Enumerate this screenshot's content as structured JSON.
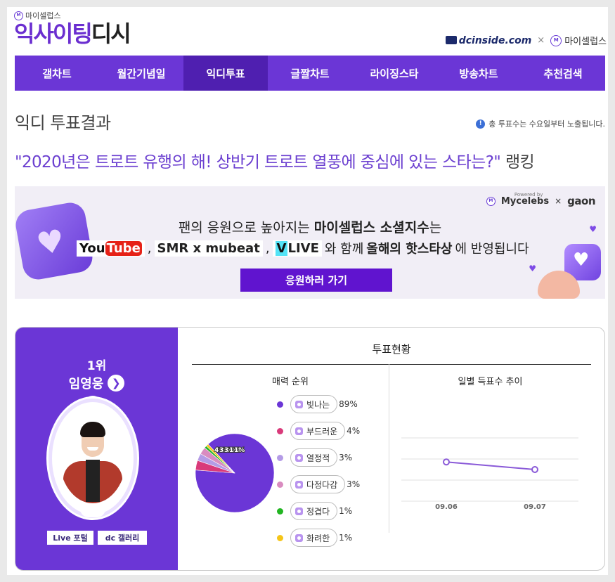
{
  "header": {
    "brand_small": "마이셀럽스",
    "brand_main": "익사이팅",
    "brand_accent": "디시",
    "partner_dc": "dcinside.com",
    "partner_times": "×",
    "partner_mc": "마이셀럽스"
  },
  "nav": {
    "items": [
      "갤차트",
      "월간기념일",
      "익디투표",
      "글짤차트",
      "라이징스타",
      "방송차트",
      "추천검색"
    ],
    "active_index": 2
  },
  "page": {
    "title": "익디 투표결과",
    "notice": "총 투표수는 수요일부터 노출됩니다.",
    "headline": "\"2020년은 트로트 유행의 해! 상반기 트로트 열풍에 중심에 있는 스타는?\"",
    "headline_suffix": "랭킹"
  },
  "banner": {
    "powered_by": "Powered by",
    "brand_a": "Mycelebs",
    "times": "×",
    "brand_b": "gaon",
    "line1_prefix": "팬의 응원으로 높아지는",
    "line1_bold": "마이셀럽스 소셜지수",
    "line1_suffix": "는",
    "yt_a": "You",
    "yt_b": "Tube",
    "comma": ",",
    "smr": "SMR x mubeat",
    "vlive_v": "V",
    "vlive_rest": "LIVE",
    "line2_prefix": "와 함께",
    "line2_bold": "올해의 핫스타상",
    "line2_suffix": "에 반영됩니다",
    "button": "응원하러 가기"
  },
  "result": {
    "rank": "1위",
    "name": "임영웅",
    "live_button": "Live 포털",
    "dc_button": "dc 갤러리",
    "panel_title": "투표현황",
    "charm_title": "매력 순위",
    "trend_title": "일별 득표수 추이",
    "pie_labels": [
      "4%",
      "3%",
      "3%",
      "1%",
      "1%"
    ]
  },
  "chart_data": [
    {
      "type": "pie",
      "title": "매력 순위",
      "categories": [
        "빛나는",
        "부드러운",
        "열정적",
        "다정다감",
        "정겹다",
        "화려한"
      ],
      "values": [
        89,
        4,
        3,
        3,
        1,
        1
      ],
      "value_labels": [
        "89%",
        "4%",
        "3%",
        "3%",
        "1%",
        "1%"
      ],
      "colors": [
        "#6b36d6",
        "#d93a7a",
        "#b49be6",
        "#d98cc0",
        "#22b522",
        "#f5c518"
      ],
      "legend": "right"
    },
    {
      "type": "line",
      "title": "일별 득표수 추이",
      "x": [
        "09.06",
        "09.07"
      ],
      "series": [
        {
          "values": [
            0.62,
            0.5
          ]
        }
      ],
      "ylim": [
        0,
        1
      ],
      "grid": true,
      "color": "#8a5ad8"
    }
  ]
}
